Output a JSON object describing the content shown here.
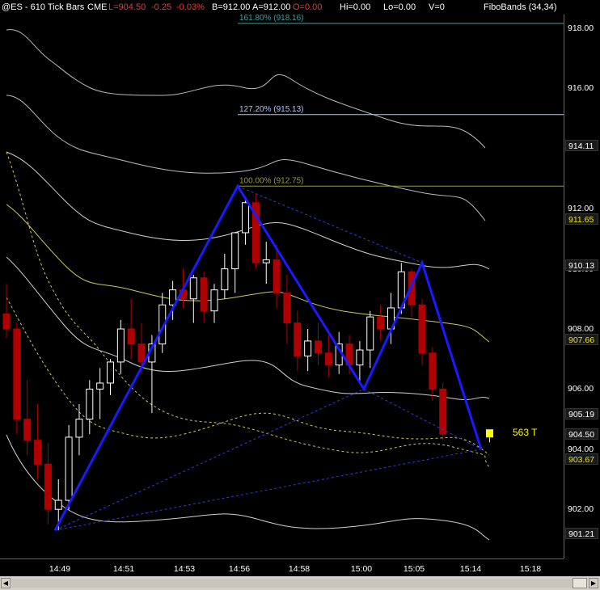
{
  "header": {
    "symbol": "@ES - 610 Tick Bars",
    "exchange": "CME",
    "last": "L=904.50",
    "change": "-0.25",
    "change_pct": "-0.03%",
    "bid": "B=912.00",
    "ask": "A=912.00",
    "open": "O=0.00",
    "high": "Hi=0.00",
    "low": "Lo=0.00",
    "volume": "V=0",
    "indicator": "FiboBands (34,34)"
  },
  "fib_levels": [
    {
      "label": "161.80% (918.16)",
      "price": 918.16,
      "color": "#3fa0a0"
    },
    {
      "label": "127.20% (915.13)",
      "price": 915.13,
      "color": "#b0c4ff"
    },
    {
      "label": "100.00% (912.75)",
      "price": 912.75,
      "color": "#9a9a40"
    }
  ],
  "price_axis": {
    "labels": [
      "918.00",
      "916.00",
      "912.00",
      "910.00",
      "908.00",
      "906.00",
      "904.00",
      "902.00"
    ],
    "boxes": [
      {
        "text": "914.11",
        "color": "#ffffff",
        "price": 914.11
      },
      {
        "text": "911.65",
        "color": "#e6e600",
        "price": 911.65
      },
      {
        "text": "910.13",
        "color": "#ffffff",
        "price": 910.13
      },
      {
        "text": "907.66",
        "color": "#e6e600",
        "price": 907.66
      },
      {
        "text": "905.19",
        "color": "#ffffff",
        "price": 905.19
      },
      {
        "text": "904.50",
        "color": "#ffffff",
        "price": 904.5
      },
      {
        "text": "903.67",
        "color": "#e6e600",
        "price": 903.67
      },
      {
        "text": "901.21",
        "color": "#ffffff",
        "price": 901.21
      }
    ]
  },
  "time_axis": [
    "14:49",
    "14:51",
    "14:53",
    "14:56",
    "14:58",
    "15:00",
    "15:05",
    "15:14",
    "15:18"
  ],
  "tick_counter": "563 T",
  "chart_data": {
    "type": "candlestick",
    "title": "@ES - 610 Tick Bars",
    "pattern_points": [
      {
        "time": "14:49",
        "price": 901.3
      },
      {
        "time": "14:56",
        "price": 912.75
      },
      {
        "time": "15:00",
        "price": 906.0
      },
      {
        "time": "15:05",
        "price": 910.2
      },
      {
        "time": "15:14",
        "price": 904.0
      }
    ],
    "candles": [
      {
        "o": 908.5,
        "h": 909.5,
        "l": 907.7,
        "c": 908.0
      },
      {
        "o": 908.0,
        "h": 908.2,
        "l": 904.5,
        "c": 905.0
      },
      {
        "o": 905.0,
        "h": 906.3,
        "l": 903.8,
        "c": 904.3
      },
      {
        "o": 904.3,
        "h": 905.5,
        "l": 903.0,
        "c": 903.5
      },
      {
        "o": 903.5,
        "h": 904.2,
        "l": 901.5,
        "c": 902.0
      },
      {
        "o": 902.0,
        "h": 903.0,
        "l": 901.3,
        "c": 902.3
      },
      {
        "o": 902.3,
        "h": 904.8,
        "l": 902.0,
        "c": 904.4
      },
      {
        "o": 904.4,
        "h": 905.5,
        "l": 903.8,
        "c": 905.0
      },
      {
        "o": 905.0,
        "h": 906.3,
        "l": 904.5,
        "c": 906.0
      },
      {
        "o": 906.0,
        "h": 906.7,
        "l": 905.0,
        "c": 906.2
      },
      {
        "o": 906.2,
        "h": 907.0,
        "l": 905.8,
        "c": 906.9
      },
      {
        "o": 906.9,
        "h": 908.3,
        "l": 906.5,
        "c": 908.0
      },
      {
        "o": 908.0,
        "h": 909.0,
        "l": 907.0,
        "c": 907.5
      },
      {
        "o": 907.5,
        "h": 908.2,
        "l": 906.5,
        "c": 906.9
      },
      {
        "o": 906.9,
        "h": 907.8,
        "l": 905.2,
        "c": 907.5
      },
      {
        "o": 907.5,
        "h": 909.2,
        "l": 907.2,
        "c": 908.8
      },
      {
        "o": 908.8,
        "h": 909.6,
        "l": 908.3,
        "c": 909.3
      },
      {
        "o": 909.3,
        "h": 910.0,
        "l": 908.7,
        "c": 909.0
      },
      {
        "o": 909.0,
        "h": 909.8,
        "l": 908.2,
        "c": 909.7
      },
      {
        "o": 909.7,
        "h": 909.9,
        "l": 908.2,
        "c": 908.6
      },
      {
        "o": 908.6,
        "h": 909.5,
        "l": 908.2,
        "c": 909.3
      },
      {
        "o": 909.3,
        "h": 910.5,
        "l": 909.0,
        "c": 910.0
      },
      {
        "o": 910.0,
        "h": 911.0,
        "l": 909.2,
        "c": 911.2
      },
      {
        "o": 911.2,
        "h": 912.4,
        "l": 910.8,
        "c": 912.2
      },
      {
        "o": 912.2,
        "h": 912.5,
        "l": 910.0,
        "c": 910.2
      },
      {
        "o": 910.2,
        "h": 910.9,
        "l": 909.5,
        "c": 910.3
      },
      {
        "o": 910.3,
        "h": 910.8,
        "l": 908.7,
        "c": 909.2
      },
      {
        "o": 909.2,
        "h": 909.8,
        "l": 907.5,
        "c": 908.2
      },
      {
        "o": 908.2,
        "h": 908.6,
        "l": 906.6,
        "c": 907.1
      },
      {
        "o": 907.1,
        "h": 908.0,
        "l": 906.6,
        "c": 907.6
      },
      {
        "o": 907.6,
        "h": 908.2,
        "l": 906.8,
        "c": 907.2
      },
      {
        "o": 907.2,
        "h": 907.8,
        "l": 906.4,
        "c": 906.8
      },
      {
        "o": 906.8,
        "h": 907.9,
        "l": 906.5,
        "c": 907.5
      },
      {
        "o": 907.5,
        "h": 907.8,
        "l": 906.5,
        "c": 906.8
      },
      {
        "o": 906.8,
        "h": 907.6,
        "l": 906.2,
        "c": 907.3
      },
      {
        "o": 907.3,
        "h": 908.6,
        "l": 906.7,
        "c": 908.4
      },
      {
        "o": 908.4,
        "h": 908.8,
        "l": 907.6,
        "c": 908.0
      },
      {
        "o": 908.0,
        "h": 909.2,
        "l": 907.5,
        "c": 908.7
      },
      {
        "o": 908.7,
        "h": 910.2,
        "l": 908.5,
        "c": 909.9
      },
      {
        "o": 909.9,
        "h": 910.0,
        "l": 908.4,
        "c": 908.8
      },
      {
        "o": 908.8,
        "h": 909.0,
        "l": 906.8,
        "c": 907.2
      },
      {
        "o": 907.2,
        "h": 907.4,
        "l": 905.6,
        "c": 906.0
      },
      {
        "o": 906.0,
        "h": 906.2,
        "l": 904.3,
        "c": 904.5
      }
    ]
  }
}
